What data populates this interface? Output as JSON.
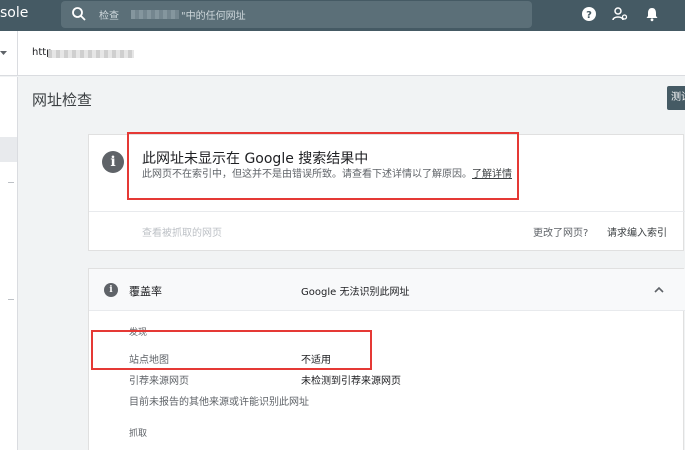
{
  "app": {
    "title": "sole"
  },
  "search": {
    "prefix": "检查",
    "suffix": "\"中的任何网址"
  },
  "property": {
    "url_prefix": "http"
  },
  "page": {
    "title": "网址检查",
    "test_button": "测试"
  },
  "status": {
    "heading": "此网址未显示在 Google 搜索结果中",
    "description": "此网页不在索引中，但这并不是由错误所致。请查看下述详情以了解原因。",
    "learn_more": "了解详情",
    "view_crawled": "查看被抓取的网页",
    "page_changed": "更改了网页?",
    "request_index": "请求编入索引"
  },
  "coverage": {
    "label": "覆盖率",
    "value": "Google 无法识别此网址",
    "discovery_title": "发现",
    "rows": [
      {
        "label": "站点地图",
        "value": "不适用"
      },
      {
        "label": "引荐来源网页",
        "value": "未检测到引荐来源网页"
      }
    ],
    "note": "目前未报告的其他来源或许能识别此网址",
    "crawl_title": "抓取"
  },
  "colors": {
    "topbar": "#455a64",
    "highlight": "#e53935"
  },
  "icons": [
    "search-icon",
    "help-icon",
    "manage-users-icon",
    "notifications-icon",
    "info-icon",
    "chevron-up-icon"
  ]
}
